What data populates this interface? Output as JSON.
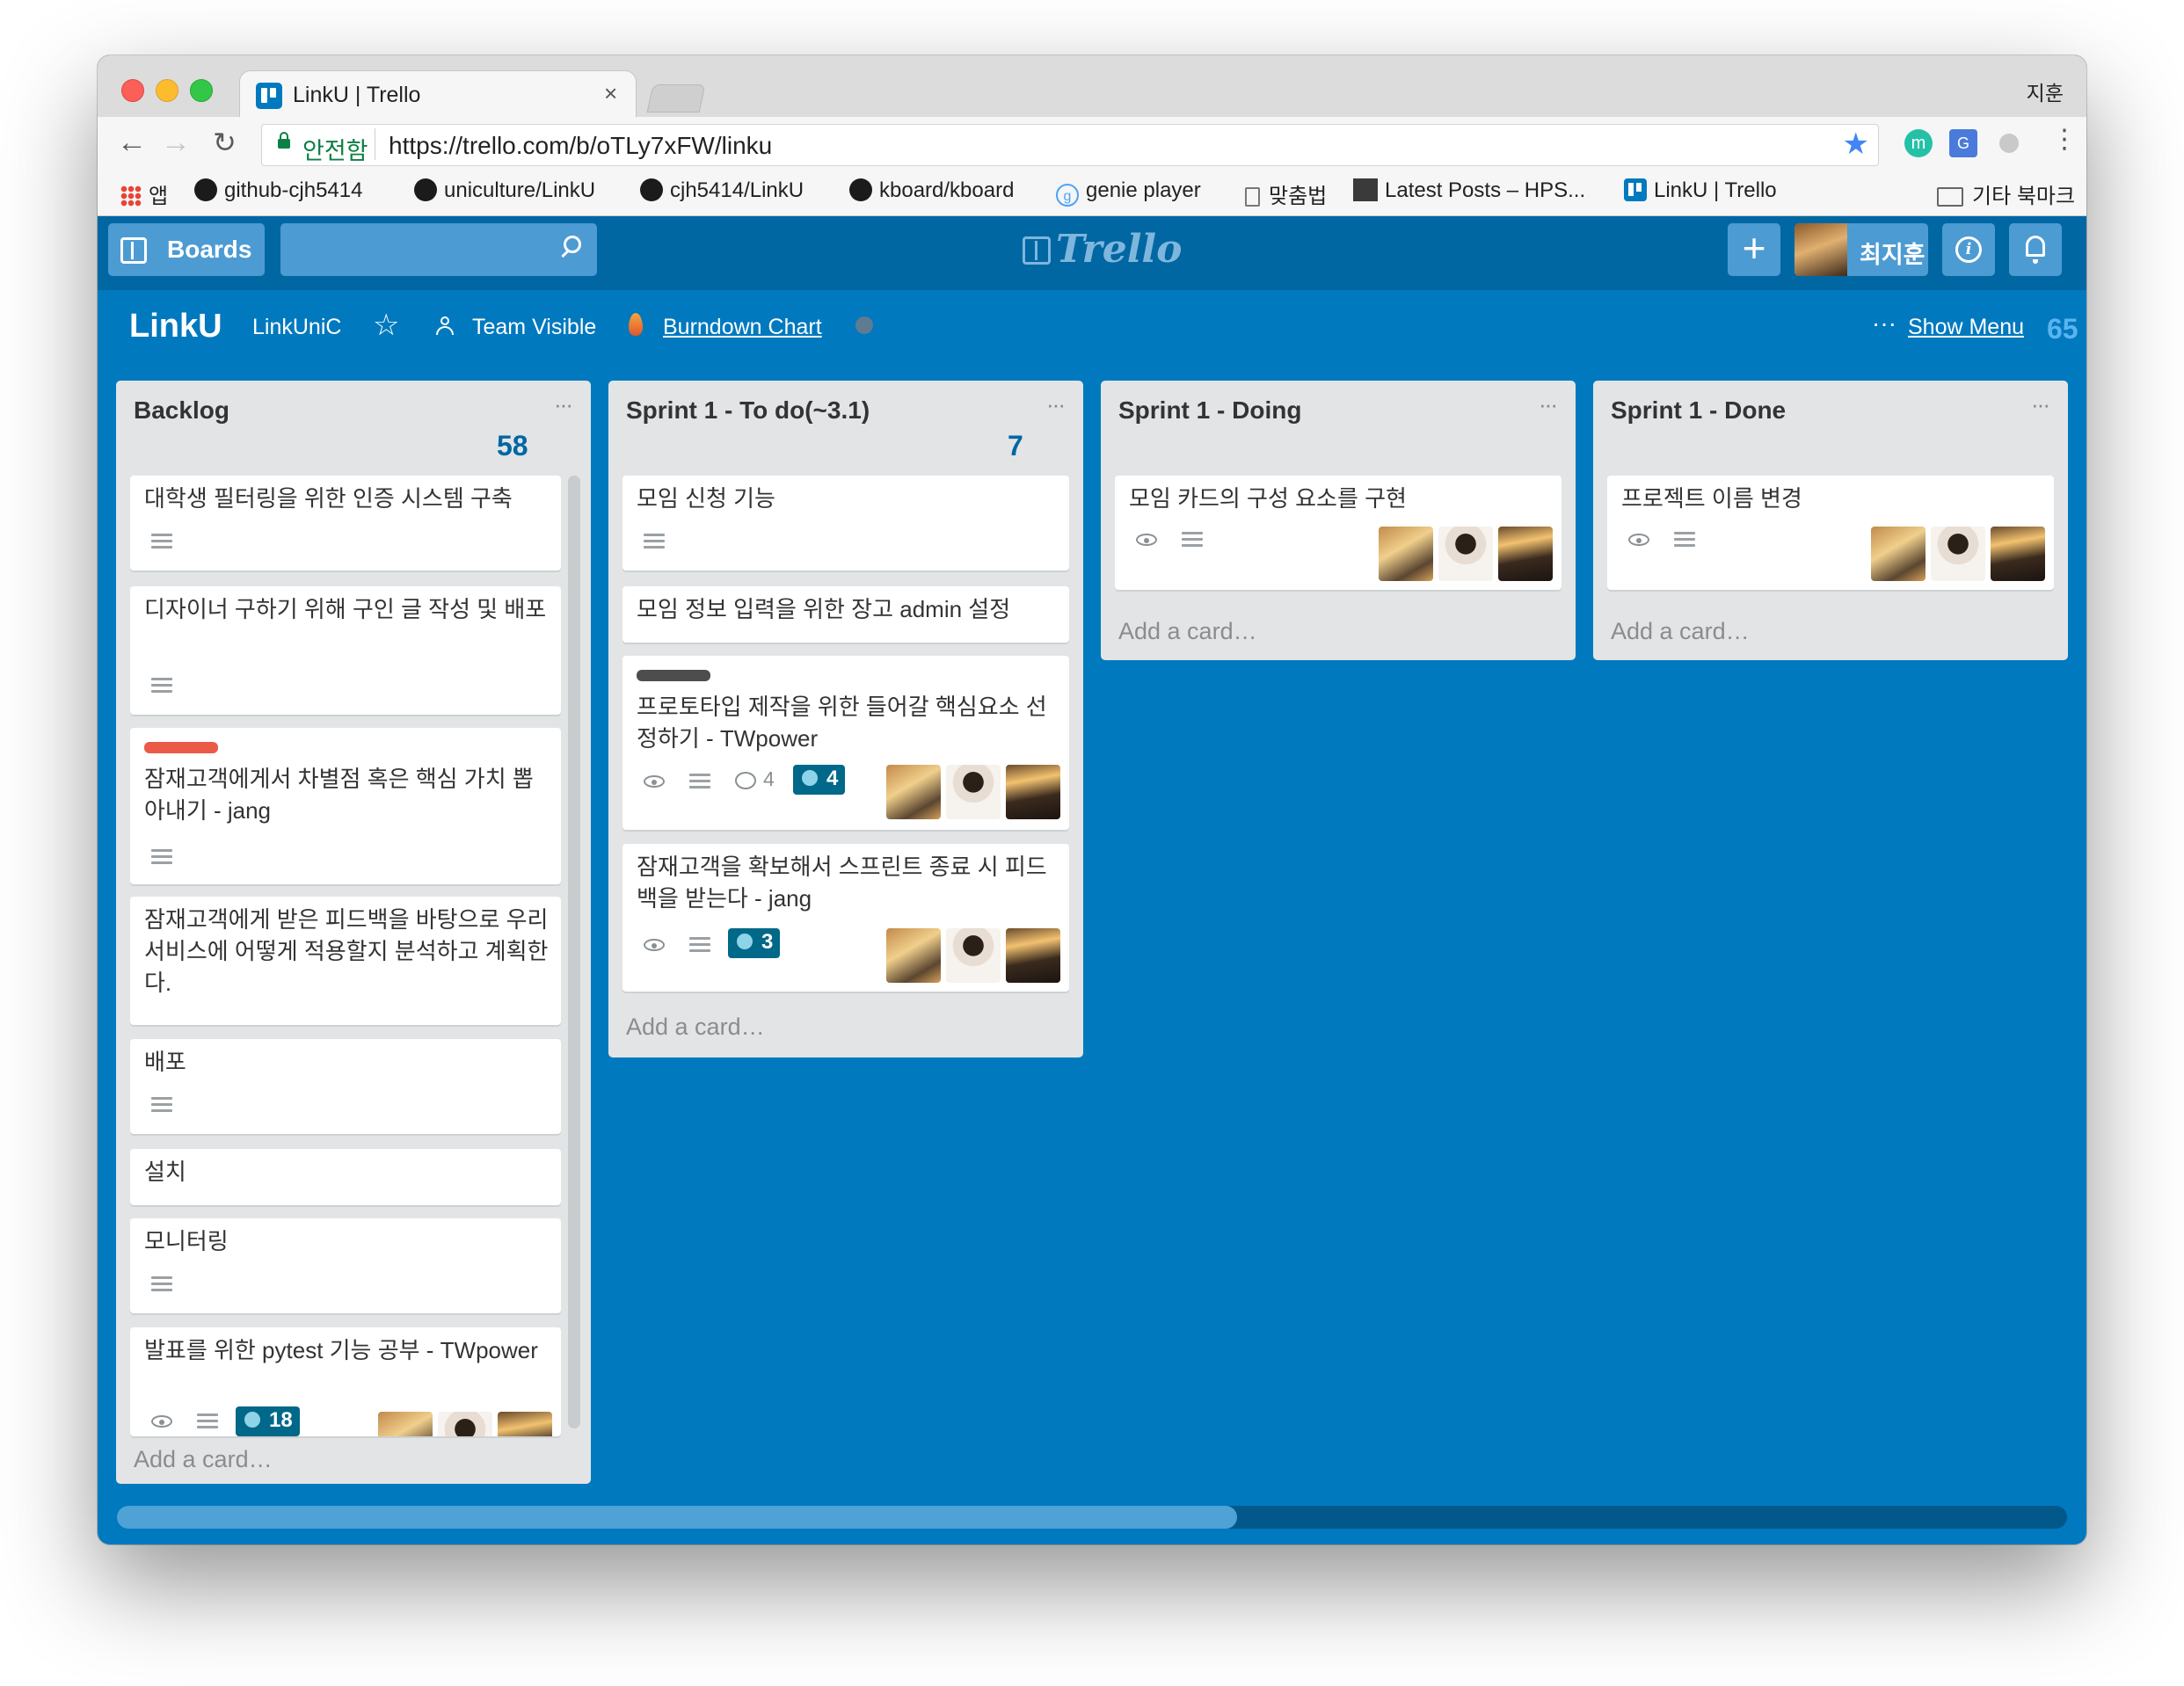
{
  "browser": {
    "tab_title": "LinkU | Trello",
    "tab_close": "×",
    "profile_name": "지훈",
    "secure_label": "안전함",
    "url": "https://trello.com/b/oTLy7xFW/linku",
    "nav_back": "←",
    "nav_forward": "→",
    "nav_reload": "↻",
    "star": "★",
    "ext_menu": "⋮",
    "ext_m": "m",
    "ext_g": "G",
    "bookmarks": {
      "apps": "앱",
      "b1": "github-cjh5414",
      "b2": "uniculture/LinkU",
      "b3": "cjh5414/LinkU",
      "b4": "kboard/kboard",
      "b5": "genie player",
      "b6": "맞춤법",
      "b7": "Latest Posts – HPS...",
      "b8": "LinkU | Trello",
      "other": "기타 북마크"
    }
  },
  "header": {
    "boards_label": "Boards",
    "logo_text": "Trello",
    "add_label": "+",
    "user_name": "최지훈",
    "info_label": "i"
  },
  "board": {
    "title": "LinkU",
    "team": "LinkUniC",
    "star": "☆",
    "visibility": "Team Visible",
    "burndown": "Burndown Chart",
    "menu_dots": "···",
    "show_menu": "Show Menu",
    "count": "65"
  },
  "lists": {
    "backlog": {
      "title": "Backlog",
      "count": "58",
      "menu": "···",
      "add_card": "Add a card…",
      "cards": [
        {
          "title": "대학생 필터링을 위한 인증 시스템 구축"
        },
        {
          "title": "디자이너 구하기 위해 구인 글 작성 및 배포"
        },
        {
          "title": "잠재고객에게서 차별점 혹은 핵심 가치 뽑아내기 - jang",
          "label_color": "#eb5a46"
        },
        {
          "title": "잠재고객에게 받은 피드백을 바탕으로 우리 서비스에 어떻게 적용할지 분석하고 계획한다."
        },
        {
          "title": "배포"
        },
        {
          "title": "설치"
        },
        {
          "title": "모니터링"
        },
        {
          "title": "발표를 위한 pytest 기능 공부 - TWpower",
          "badge": "18"
        }
      ]
    },
    "todo": {
      "title": "Sprint 1 - To do(~3.1)",
      "count": "7",
      "menu": "···",
      "add_card": "Add a card…",
      "cards": [
        {
          "title": "모임 신청 기능"
        },
        {
          "title": "모임 정보 입력을 위한 장고 admin 설정"
        },
        {
          "title": "프로토타입 제작을 위한 들어갈 핵심요소 선정하기 - TWpower",
          "label_color": "#4d4d4d",
          "comments": "4",
          "badge": "4"
        },
        {
          "title": "잠재고객을 확보해서 스프린트 종료 시 피드백을 받는다 - jang",
          "badge": "3"
        }
      ]
    },
    "doing": {
      "title": "Sprint 1 - Doing",
      "menu": "···",
      "add_card": "Add a card…",
      "cards": [
        {
          "title": "모임 카드의 구성 요소를 구현"
        }
      ]
    },
    "done": {
      "title": "Sprint 1 - Done",
      "menu": "···",
      "add_card": "Add a card…",
      "cards": [
        {
          "title": "프로젝트 이름 변경"
        }
      ]
    }
  }
}
